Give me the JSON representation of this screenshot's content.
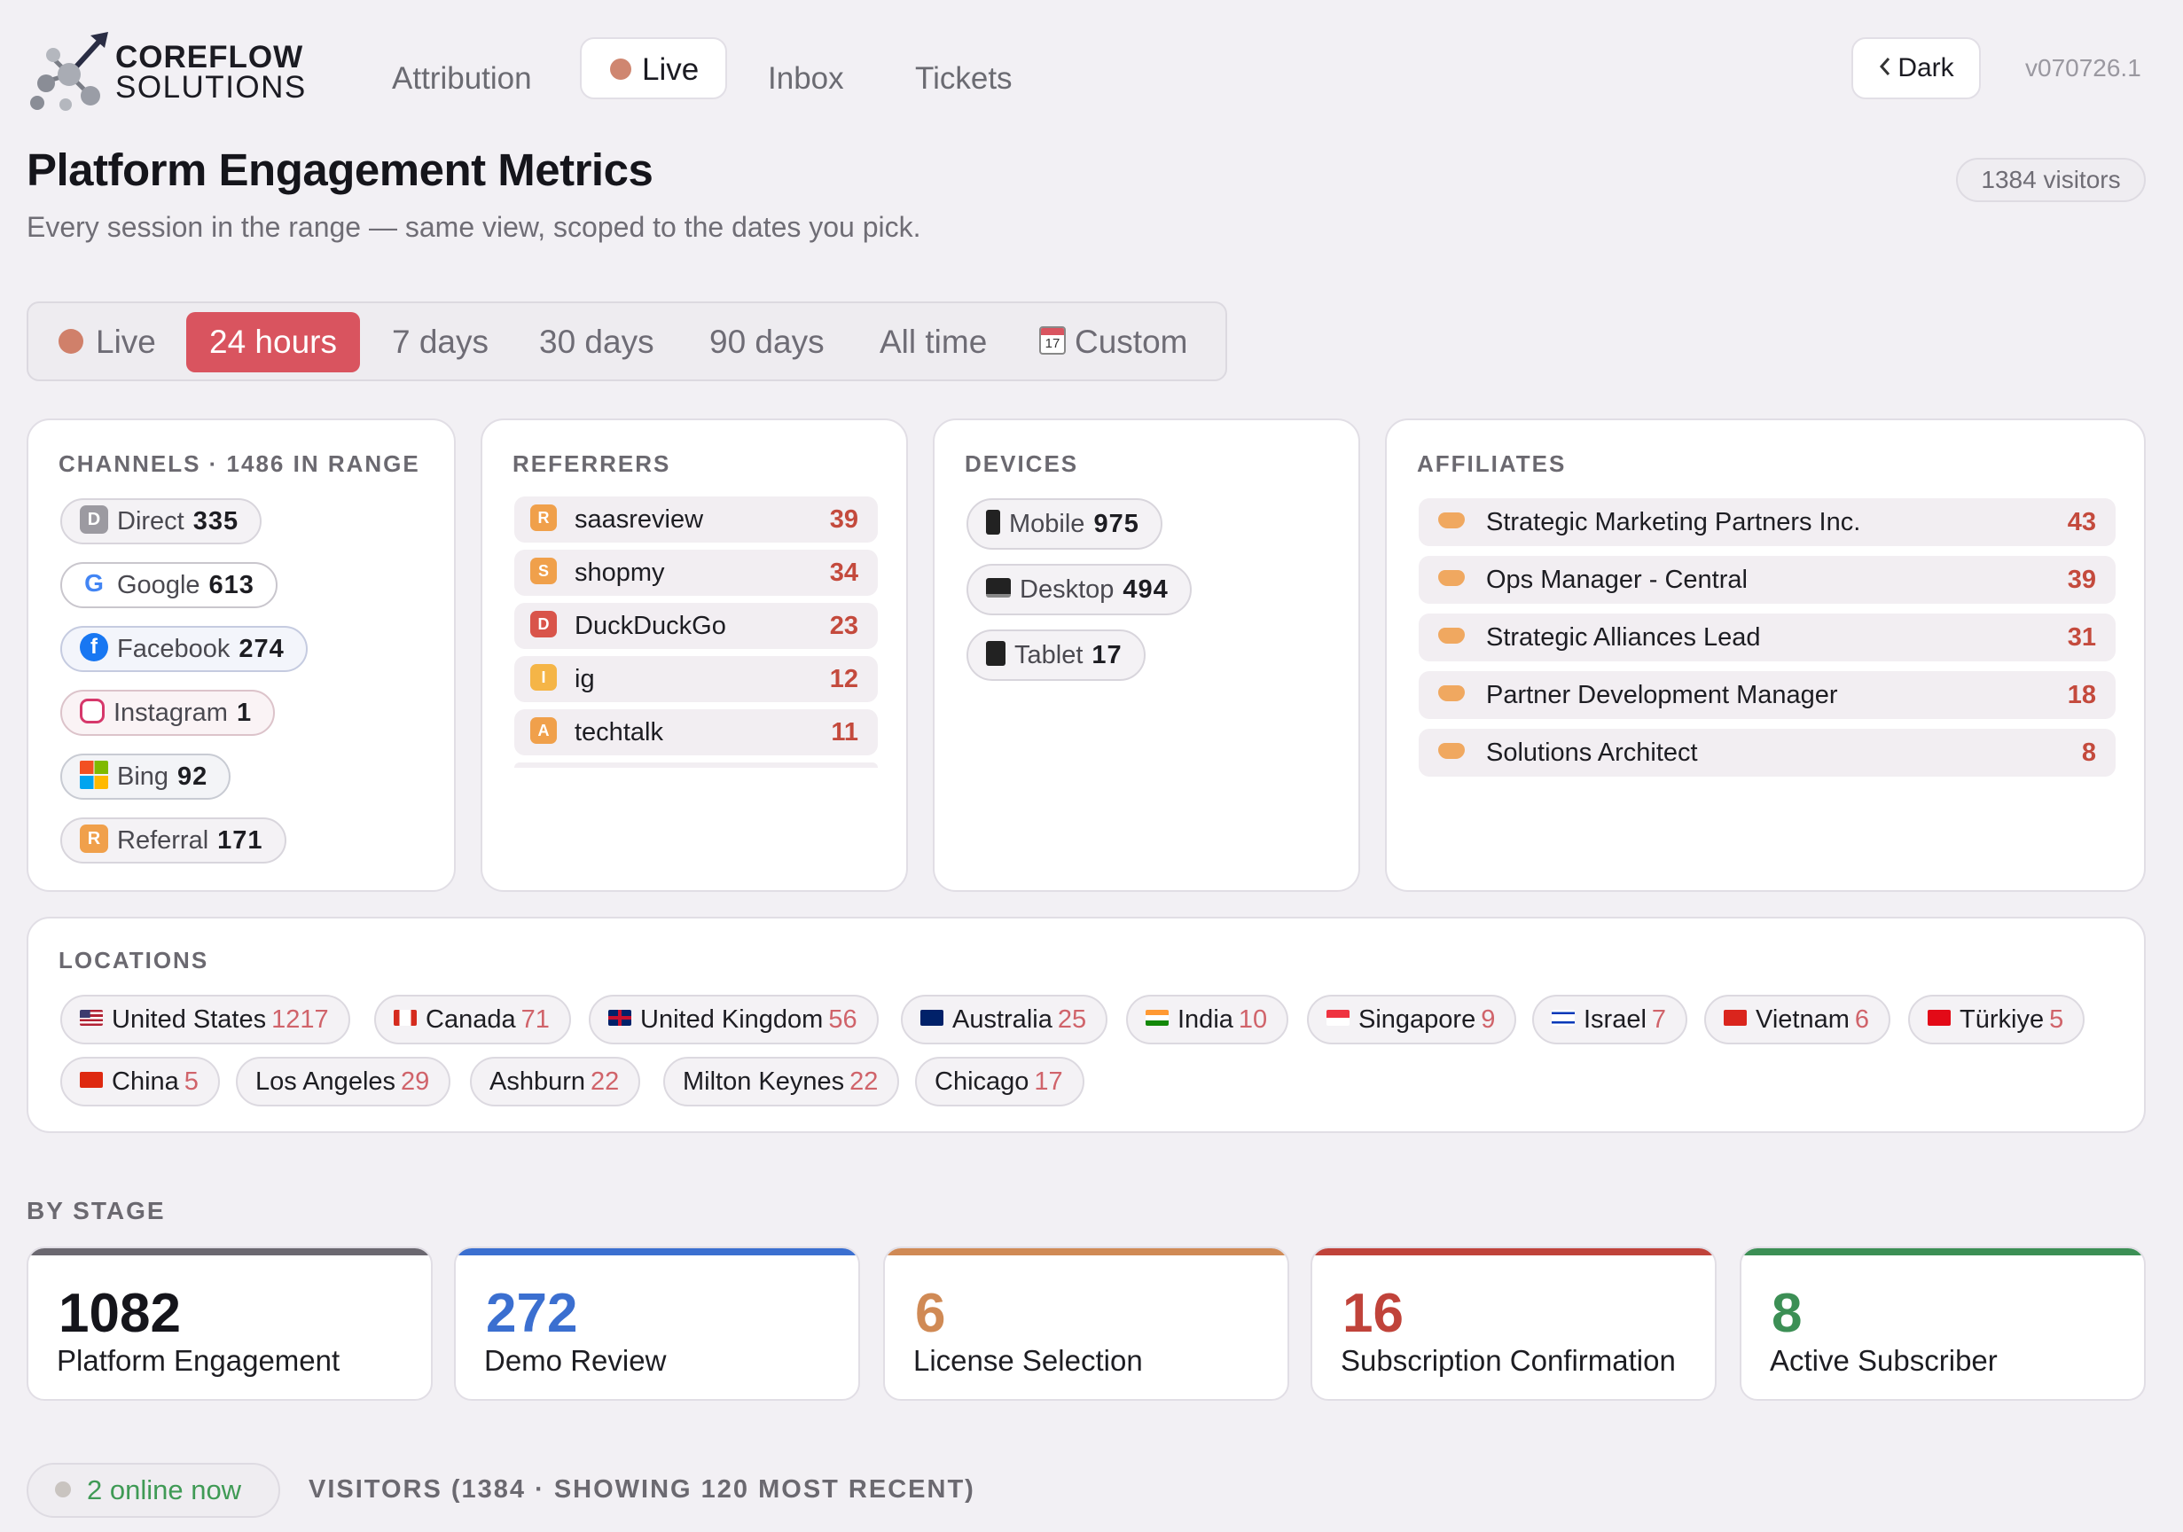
{
  "brand": {
    "line1": "COREFLOW",
    "line2": "SOLUTIONS"
  },
  "nav": {
    "items": [
      {
        "label": "Attribution"
      },
      {
        "label": "Live"
      },
      {
        "label": "Inbox"
      },
      {
        "label": "Tickets"
      }
    ],
    "theme_button": "Dark",
    "version": "v070726.1"
  },
  "header": {
    "title": "Platform Engagement Metrics",
    "subtitle": "Every session in the range — same view, scoped to the dates you pick.",
    "visitors": "1384 visitors"
  },
  "range": {
    "tabs": [
      {
        "label": "Live"
      },
      {
        "label": "24 hours",
        "active": true
      },
      {
        "label": "7 days"
      },
      {
        "label": "30 days"
      },
      {
        "label": "90 days"
      },
      {
        "label": "All time"
      },
      {
        "label": "Custom"
      }
    ],
    "calendar_day": "17"
  },
  "channels": {
    "title": "CHANNELS · 1486 IN RANGE",
    "items": [
      {
        "name": "Direct",
        "value": "335",
        "icon": "direct-icon",
        "letter": "D"
      },
      {
        "name": "Google",
        "value": "613",
        "icon": "google-icon",
        "letter": "G"
      },
      {
        "name": "Facebook",
        "value": "274",
        "icon": "facebook-icon",
        "letter": "f"
      },
      {
        "name": "Instagram",
        "value": "1",
        "icon": "instagram-icon",
        "letter": ""
      },
      {
        "name": "Bing",
        "value": "92",
        "icon": "bing-icon",
        "letter": ""
      },
      {
        "name": "Referral",
        "value": "171",
        "icon": "referral-icon",
        "letter": "R"
      }
    ]
  },
  "referrers": {
    "title": "REFERRERS",
    "items": [
      {
        "name": "saasreview",
        "value": "39",
        "letter": "R"
      },
      {
        "name": "shopmy",
        "value": "34",
        "letter": "S"
      },
      {
        "name": "DuckDuckGo",
        "value": "23",
        "letter": "D"
      },
      {
        "name": "ig",
        "value": "12",
        "letter": "I"
      },
      {
        "name": "techtalk",
        "value": "11",
        "letter": "A"
      }
    ]
  },
  "devices": {
    "title": "DEVICES",
    "items": [
      {
        "name": "Mobile",
        "value": "975",
        "icon": "mobile-icon"
      },
      {
        "name": "Desktop",
        "value": "494",
        "icon": "desktop-icon"
      },
      {
        "name": "Tablet",
        "value": "17",
        "icon": "tablet-icon"
      }
    ]
  },
  "affiliates": {
    "title": "AFFILIATES",
    "items": [
      {
        "name": "Strategic Marketing Partners Inc.",
        "value": "43"
      },
      {
        "name": "Ops Manager - Central",
        "value": "39"
      },
      {
        "name": "Strategic Alliances Lead",
        "value": "31"
      },
      {
        "name": "Partner Development Manager",
        "value": "18"
      },
      {
        "name": "Solutions Architect",
        "value": "8"
      }
    ]
  },
  "locations": {
    "title": "LOCATIONS",
    "items": [
      {
        "name": "United States",
        "value": "1217"
      },
      {
        "name": "Canada",
        "value": "71"
      },
      {
        "name": "United Kingdom",
        "value": "56"
      },
      {
        "name": "Australia",
        "value": "25"
      },
      {
        "name": "India",
        "value": "10"
      },
      {
        "name": "Singapore",
        "value": "9"
      },
      {
        "name": "Israel",
        "value": "7"
      },
      {
        "name": "Vietnam",
        "value": "6"
      },
      {
        "name": "Türkiye",
        "value": "5"
      },
      {
        "name": "China",
        "value": "5"
      },
      {
        "name": "Los Angeles",
        "value": "29"
      },
      {
        "name": "Ashburn",
        "value": "22"
      },
      {
        "name": "Milton Keynes",
        "value": "22"
      },
      {
        "name": "Chicago",
        "value": "17"
      }
    ]
  },
  "stages": {
    "title": "BY STAGE",
    "items": [
      {
        "value": "1082",
        "label": "Platform Engagement",
        "color": "#6b6870"
      },
      {
        "value": "272",
        "label": "Demo Review",
        "color": "#3b6fd0"
      },
      {
        "value": "6",
        "label": "License Selection",
        "color": "#d08a55"
      },
      {
        "value": "16",
        "label": "Subscription Confirmation",
        "color": "#c0433a"
      },
      {
        "value": "8",
        "label": "Active Subscriber",
        "color": "#3c8f55"
      }
    ]
  },
  "footer": {
    "online": "2 online now",
    "visitors_heading": "VISITORS (1384 · SHOWING 120 MOST RECENT)"
  }
}
